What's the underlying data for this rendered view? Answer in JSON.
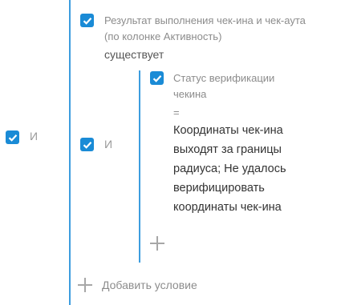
{
  "root_group": {
    "operator": "И",
    "checked": true
  },
  "condition_1": {
    "checked": true,
    "lines": [
      "Результат выполнения чек-ина и чек-аута",
      "(по колонке Активность)"
    ],
    "comparison": "существует"
  },
  "nested_group": {
    "operator": "И",
    "checked": true,
    "condition": {
      "checked": true,
      "lines": [
        "Статус верификации",
        "чекина"
      ],
      "comparison": "=",
      "value_lines": [
        "Координаты чек-ина",
        "выходят за границы",
        "радиуса; Не удалось",
        "верифицировать",
        "координаты чек-ина"
      ]
    }
  },
  "add_condition_label": "Добавить условие",
  "accent_color": "#1a8bd6",
  "icons": {
    "checkbox": "check-icon",
    "add": "plus-icon"
  }
}
